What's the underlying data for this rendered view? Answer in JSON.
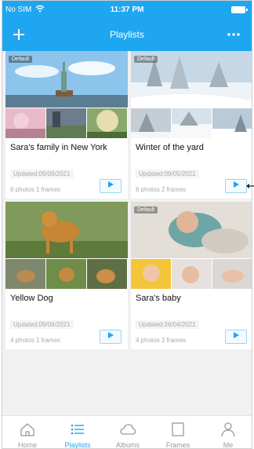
{
  "status_bar": {
    "carrier": "No SIM",
    "time": "11:37 PM"
  },
  "header": {
    "title": "Playlists",
    "add_icon": "plus-icon",
    "more_icon": "more-icon"
  },
  "playlists": [
    {
      "title": "Sara's family in New York",
      "updated": "Updated:09/06/2021",
      "meta": "6 photos  1 frames",
      "default": "Default",
      "play_icon": "play-icon"
    },
    {
      "title": "Winter of the yard",
      "updated": "Updated:09/05/2021",
      "meta": "6 photos  2 frames",
      "default": "Default",
      "play_icon": "play-icon"
    },
    {
      "title": "Yellow Dog",
      "updated": "Updated:09/06/2021",
      "meta": "4 photos  1 frames",
      "default": "",
      "play_icon": "play-icon"
    },
    {
      "title": "Sara's baby",
      "updated": "Updated:26/04/2021",
      "meta": "4 photos  2 frames",
      "default": "Default",
      "play_icon": "play-icon"
    }
  ],
  "tabs": [
    {
      "label": "Home",
      "icon": "home-icon",
      "active": false
    },
    {
      "label": "Playlists",
      "icon": "list-icon",
      "active": true
    },
    {
      "label": "Albums",
      "icon": "cloud-icon",
      "active": false
    },
    {
      "label": "Frames",
      "icon": "frame-icon",
      "active": false
    },
    {
      "label": "Me",
      "icon": "person-icon",
      "active": false
    }
  ],
  "colors": {
    "accent": "#1ea6f0",
    "background": "#f1f1f1",
    "muted_text": "#a9a9a9"
  }
}
